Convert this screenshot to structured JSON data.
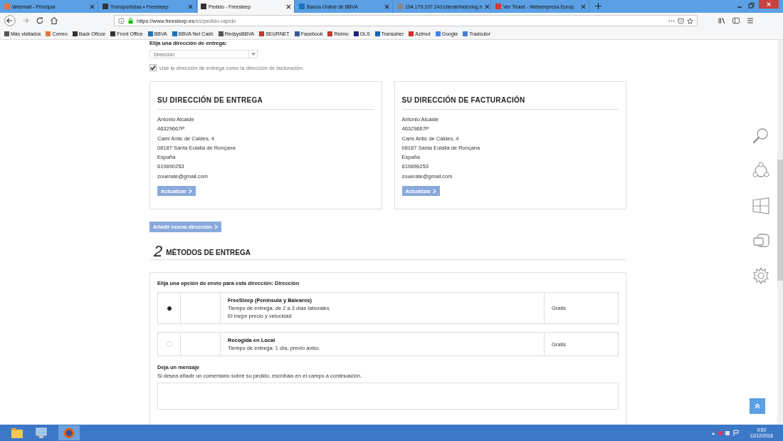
{
  "browser": {
    "tabs": [
      {
        "title": "Webmail - Principal",
        "selected": false,
        "color": "#e8743b"
      },
      {
        "title": "Transportistas • Freesleep",
        "selected": false,
        "color": "#333333"
      },
      {
        "title": "Pedido - Freesleep",
        "selected": true,
        "color": "#333333"
      },
      {
        "title": "Banca Online de BBVA",
        "selected": false,
        "color": "#1973b8"
      },
      {
        "title": "194.179.107.241/cliente/indexlog.h",
        "selected": false,
        "color": "#888888"
      },
      {
        "title": "Ver Ticket - Webempresa Europ",
        "selected": false,
        "color": "#d9352b"
      }
    ],
    "url_host": "https://www.freesleep.es",
    "url_path": "/es/pedido-rapido",
    "bookmarks": [
      {
        "label": "Más visitados",
        "color": "#555555"
      },
      {
        "label": "Correo",
        "color": "#e8743b"
      },
      {
        "label": "Back Oficce",
        "color": "#333333"
      },
      {
        "label": "Front Office",
        "color": "#333333"
      },
      {
        "label": "BBVA",
        "color": "#1973b8"
      },
      {
        "label": "BBVA Net Cash",
        "color": "#1973b8"
      },
      {
        "label": "RedsysBBVA",
        "color": "#555555"
      },
      {
        "label": "SEURNET",
        "color": "#c0392b"
      },
      {
        "label": "Facebook",
        "color": "#3b5998"
      },
      {
        "label": "Reimo",
        "color": "#c0392b"
      },
      {
        "label": "GLS",
        "color": "#1a237e"
      },
      {
        "label": "Transaher",
        "color": "#1565c0"
      },
      {
        "label": "Azimut",
        "color": "#d32f2f"
      },
      {
        "label": "Google",
        "color": "#4285f4"
      },
      {
        "label": "Tradcutor",
        "color": "#4a7bd0"
      }
    ]
  },
  "page": {
    "address_label": "Elija una dirección de entrega:",
    "address_select": "Dirección",
    "same_billing": {
      "label": "Use la dirección de entrega como la dirección de facturación.",
      "checked": true
    },
    "cards": [
      {
        "title": "SU DIRECCIÓN DE ENTREGA",
        "lines": [
          "Antonio Alcaide",
          "46329667P",
          "Cami Antic de Caldes, 4",
          "08187 Santa Eulalia de Ronçana",
          "España",
          "619890253",
          "zouerate@gmail.com"
        ],
        "button": "Actualizar"
      },
      {
        "title": "SU DIRECCIÓN DE FACTURACIÓN",
        "lines": [
          "Antonio Alcaide",
          "46329667P",
          "Cami Antic de Caldes, 4",
          "08187 Santa Eulalia de Ronçana",
          "España",
          "619890253",
          "zouerate@gmail.com"
        ],
        "button": "Actualizar"
      }
    ],
    "add_address": "Añadir nueva dirección",
    "section": {
      "number": "2",
      "title": "MÉTODOS DE ENTREGA"
    },
    "shipping_prompt": "Elija una opción de envío para esta dirección: Dirección",
    "options": [
      {
        "name": "FreeSleep (Peninsula y Baleares)",
        "lines": [
          "Tiempo de entrega: de 2 a 3 días laborales",
          "El mejor precio y velocidad"
        ],
        "price": "Gratis",
        "selected": true
      },
      {
        "name": "Recogida en Local",
        "lines": [
          "Tiempo de entrega: 1 día, previo aviso."
        ],
        "price": "Gratis",
        "selected": false
      }
    ],
    "message": {
      "title": "Deja un mensaje",
      "hint": "Si desea añadir un comentario sobre su pedido, escríbalo en el campo a continuación."
    }
  },
  "clock": {
    "time": "9:50",
    "date": "13/12/2018"
  }
}
